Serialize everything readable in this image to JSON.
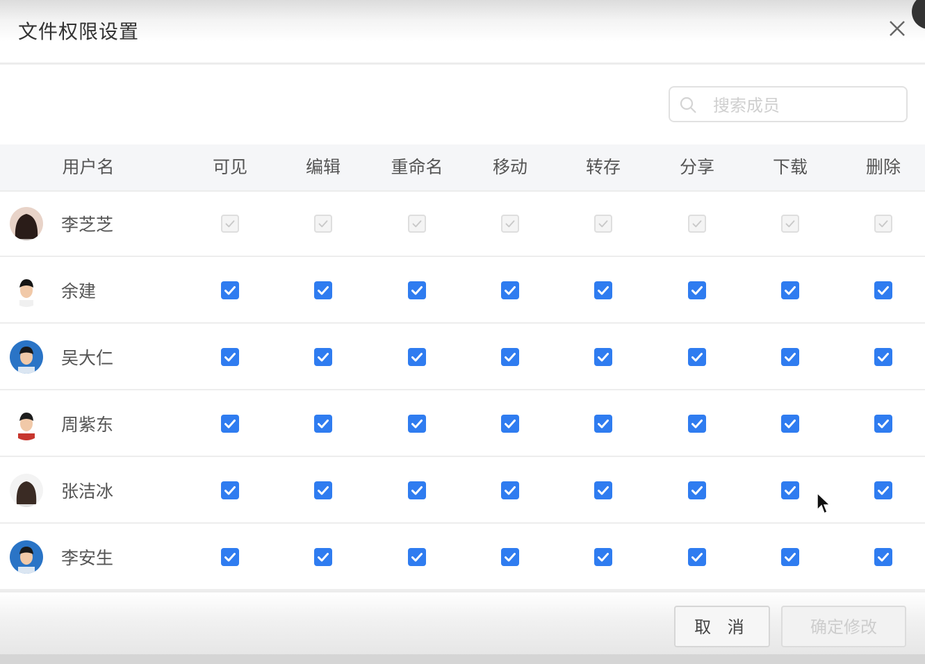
{
  "dialog": {
    "title": "文件权限设置",
    "search_placeholder": "搜索成员",
    "cancel_label": "取 消",
    "confirm_label": "确定修改"
  },
  "columns": [
    "用户名",
    "可见",
    "编辑",
    "重命名",
    "移动",
    "转存",
    "分享",
    "下载",
    "删除"
  ],
  "users": [
    {
      "name": "李芝芝",
      "permissions": [
        true,
        true,
        true,
        true,
        true,
        true,
        true,
        true
      ],
      "disabled": true,
      "avatar": "woman-long-dark-hair"
    },
    {
      "name": "余建",
      "permissions": [
        true,
        true,
        true,
        true,
        true,
        true,
        true,
        true
      ],
      "disabled": false,
      "avatar": "man-short-hair"
    },
    {
      "name": "吴大仁",
      "permissions": [
        true,
        true,
        true,
        true,
        true,
        true,
        true,
        true
      ],
      "disabled": false,
      "avatar": "man-blue-background"
    },
    {
      "name": "周紫东",
      "permissions": [
        true,
        true,
        true,
        true,
        true,
        true,
        true,
        true
      ],
      "disabled": false,
      "avatar": "man-red-shirt"
    },
    {
      "name": "张洁冰",
      "permissions": [
        true,
        true,
        true,
        true,
        true,
        true,
        true,
        true
      ],
      "disabled": false,
      "avatar": "woman-white-background"
    },
    {
      "name": "李安生",
      "permissions": [
        true,
        true,
        true,
        true,
        true,
        true,
        true,
        true
      ],
      "disabled": false,
      "avatar": "man-blue-background"
    }
  ],
  "colors": {
    "accent": "#2f7cf0",
    "disabled_checkbox": "#f4f4f4"
  },
  "icons": {
    "close": "close-icon",
    "search": "search-icon",
    "checkbox": "checkmark-icon"
  }
}
